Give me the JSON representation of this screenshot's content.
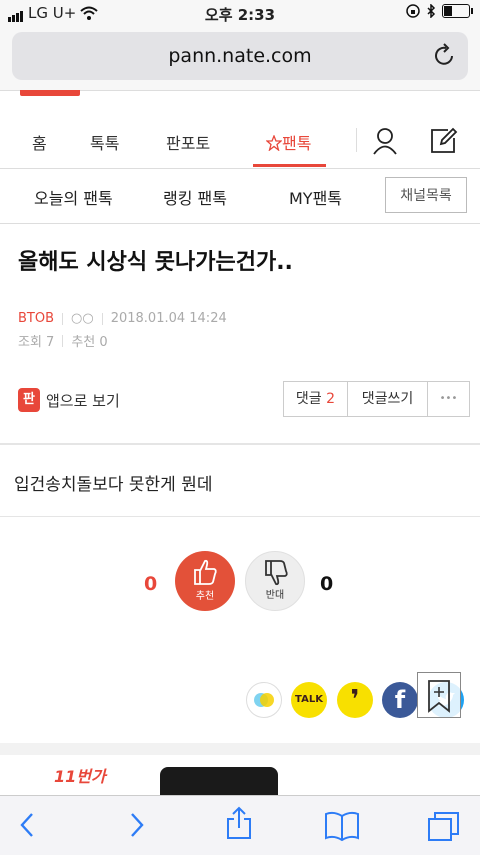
{
  "status_bar": {
    "carrier": "LG U+",
    "time": "오후 2:33"
  },
  "browser": {
    "url": "pann.nate.com"
  },
  "top_nav": {
    "tabs": [
      "홈",
      "톡톡",
      "판포토",
      "팬톡"
    ]
  },
  "sub_nav": {
    "tabs": [
      "오늘의 팬톡",
      "랭킹 팬톡",
      "MY팬톡"
    ],
    "channel_list": "채널목록"
  },
  "post": {
    "title": "올해도 시상식 못나가는건가..",
    "author": "BTOB",
    "nickname": "○○",
    "datetime": "2018.01.04 14:24",
    "views_label": "조회 7",
    "recommend_label": "추천 0",
    "body": "입건송치돌보다 못한게 뭔데"
  },
  "actions": {
    "app_view": "앱으로 보기",
    "app_icon_glyph": "판",
    "comment_label": "댓글",
    "comment_count": "2",
    "write_comment": "댓글쓰기",
    "more": "•••"
  },
  "vote": {
    "up_label": "추천",
    "up_count": "0",
    "down_label": "반대",
    "down_count": "0"
  },
  "share": {
    "kakaotalk": "TALK",
    "kakaopage": "❜",
    "facebook": "f"
  },
  "ad": {
    "brand": "11번가"
  },
  "colors": {
    "accent": "#e8473a",
    "facebook": "#3b5998",
    "kakao": "#f8e000",
    "twitter": "#1da1f2"
  }
}
